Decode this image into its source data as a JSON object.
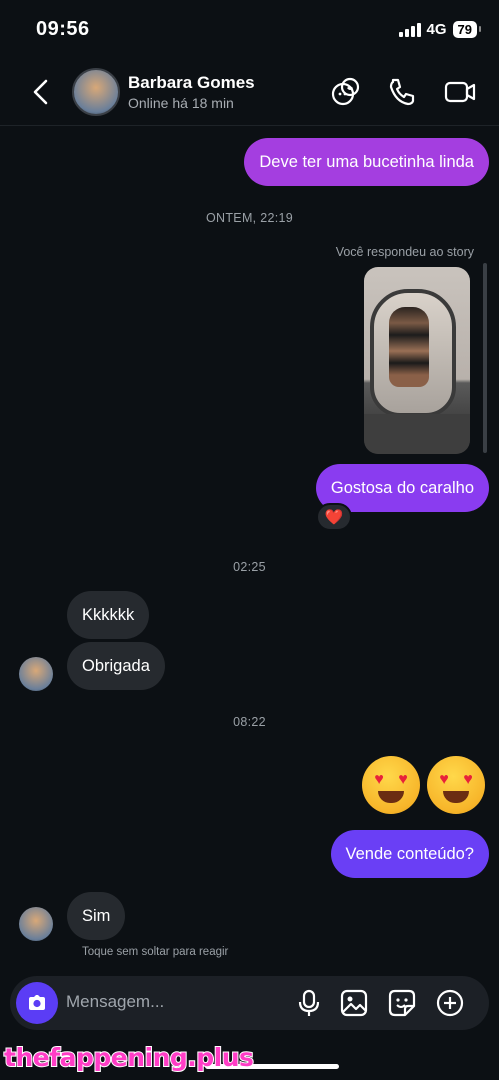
{
  "status_bar": {
    "time": "09:56",
    "network": "4G",
    "battery": "79"
  },
  "header": {
    "contact_name": "Barbara Gomes",
    "contact_status": "Online há 18 min",
    "icons": [
      "back-chevron-icon",
      "effects-icon",
      "phone-icon",
      "video-camera-icon"
    ]
  },
  "chat": {
    "messages": [
      {
        "direction": "out",
        "text": "Deve ter uma bucetinha linda"
      },
      {
        "type": "timestamp",
        "text": "ONTEM, 22:19"
      },
      {
        "type": "note",
        "text": "Você respondeu ao story"
      },
      {
        "direction": "out",
        "text": "Gostosa do caralho",
        "reaction": "❤️"
      },
      {
        "type": "timestamp",
        "text": "02:25"
      },
      {
        "direction": "in",
        "text": "Kkkkkk"
      },
      {
        "direction": "in",
        "text": "Obrigada"
      },
      {
        "type": "timestamp",
        "text": "08:22"
      },
      {
        "direction": "out",
        "text": "😍😍",
        "kind": "emoji"
      },
      {
        "direction": "out",
        "text": "Vende conteúdo?"
      },
      {
        "direction": "in",
        "text": "Sim"
      },
      {
        "type": "hint",
        "text": "Toque sem soltar para reagir"
      }
    ]
  },
  "composer": {
    "placeholder": "Mensagem...",
    "icons": [
      "camera-icon",
      "microphone-icon",
      "gallery-icon",
      "sticker-icon",
      "add-icon"
    ]
  },
  "watermark": "thefappening.plus",
  "colors": {
    "background": "#0c1014",
    "outgoing": "#8a3cf0",
    "incoming": "#262a2f",
    "accent": "#5b3df5"
  }
}
